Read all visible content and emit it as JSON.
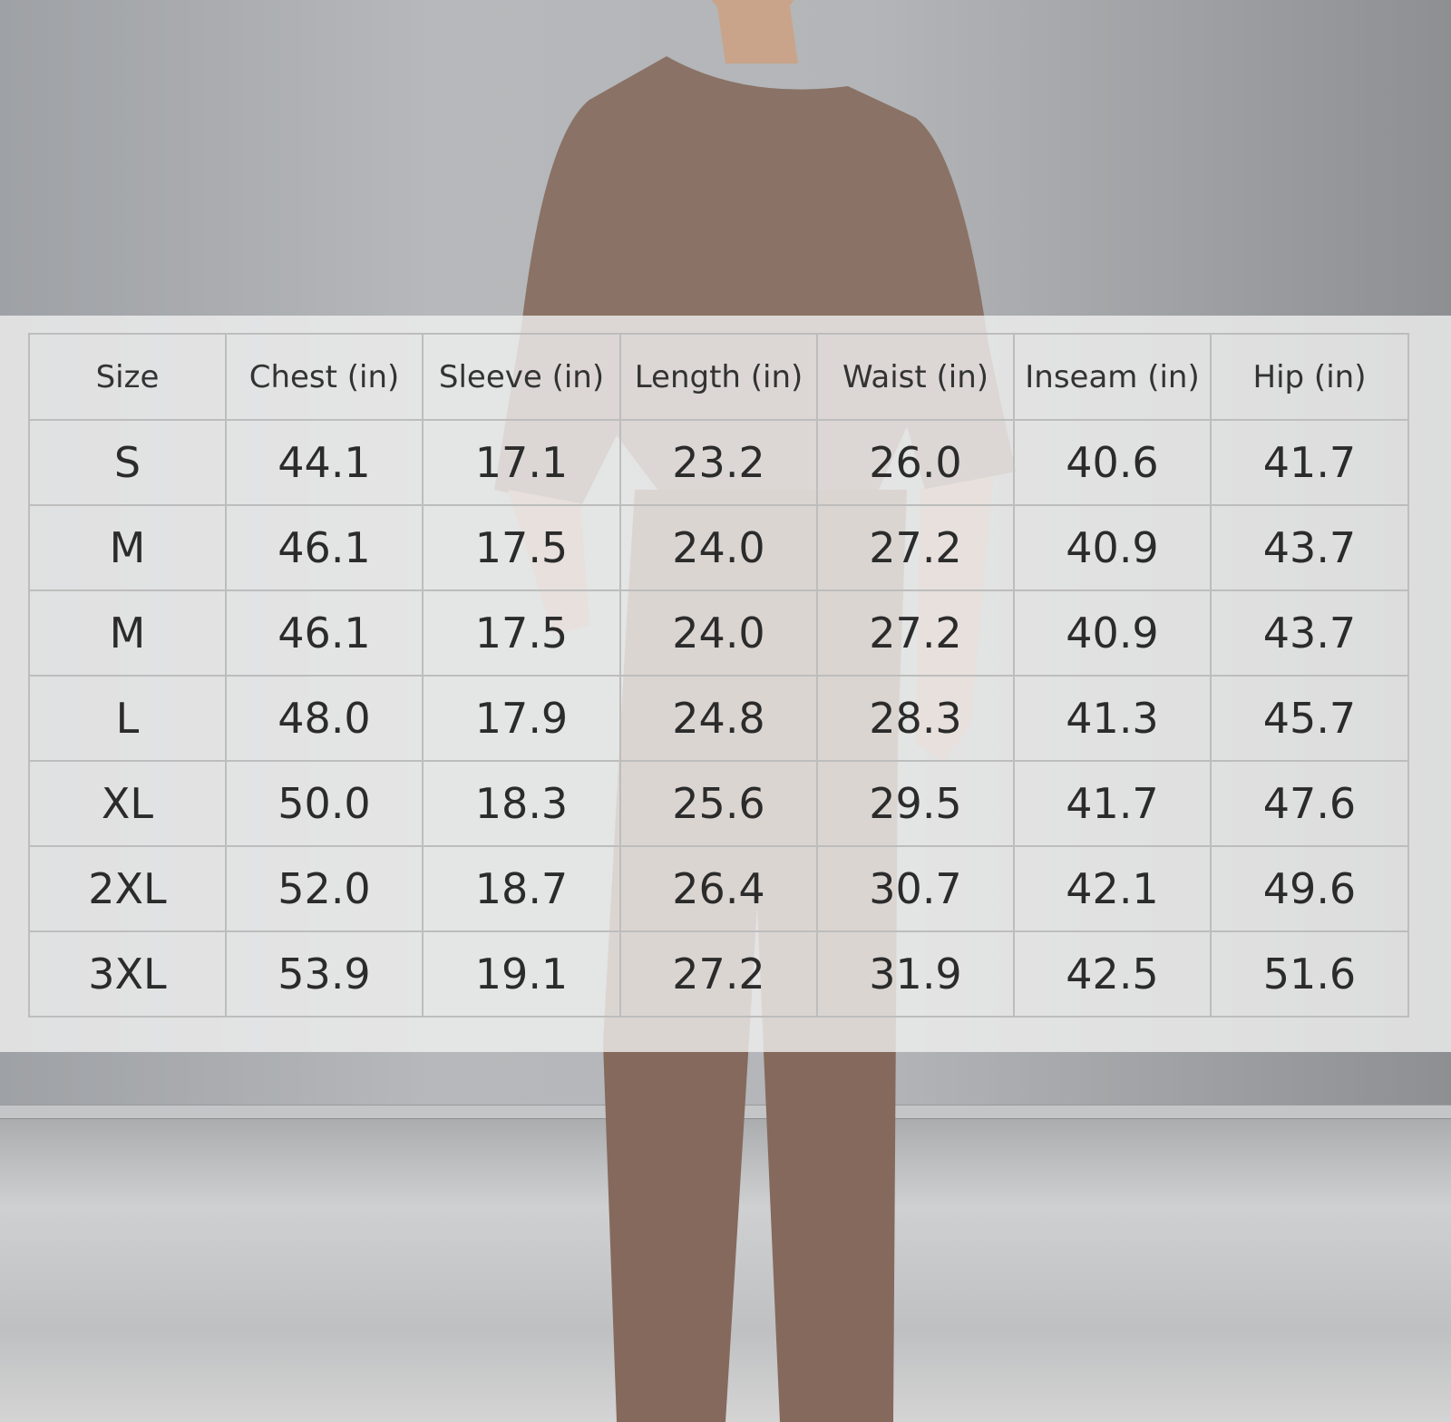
{
  "colors": {
    "garment": "#8a7266",
    "background": "#a8aaad",
    "overlay": "#f0f0f0",
    "grid": "#bdbdbd",
    "text": "#2b2b2b"
  },
  "size_chart": {
    "headers": [
      "Size",
      "Chest (in)",
      "Sleeve (in)",
      "Length (in)",
      "Waist (in)",
      "Inseam (in)",
      "Hip (in)"
    ],
    "rows": [
      [
        "S",
        "44.1",
        "17.1",
        "23.2",
        "26.0",
        "40.6",
        "41.7"
      ],
      [
        "M",
        "46.1",
        "17.5",
        "24.0",
        "27.2",
        "40.9",
        "43.7"
      ],
      [
        "M",
        "46.1",
        "17.5",
        "24.0",
        "27.2",
        "40.9",
        "43.7"
      ],
      [
        "L",
        "48.0",
        "17.9",
        "24.8",
        "28.3",
        "41.3",
        "45.7"
      ],
      [
        "XL",
        "50.0",
        "18.3",
        "25.6",
        "29.5",
        "41.7",
        "47.6"
      ],
      [
        "2XL",
        "52.0",
        "18.7",
        "26.4",
        "30.7",
        "42.1",
        "49.6"
      ],
      [
        "3XL",
        "53.9",
        "19.1",
        "27.2",
        "31.9",
        "42.5",
        "51.6"
      ]
    ]
  }
}
